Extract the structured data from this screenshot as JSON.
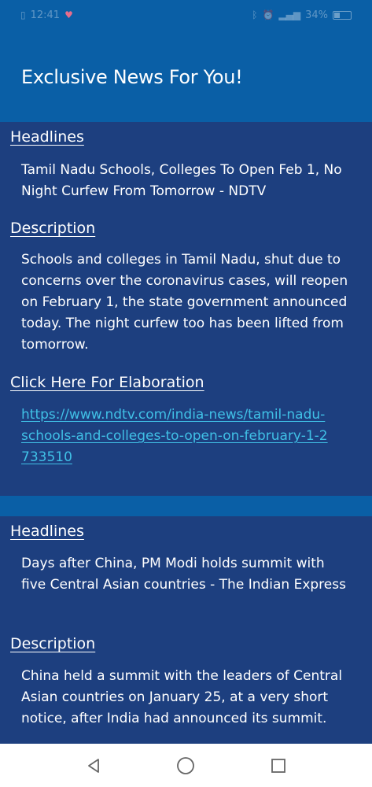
{
  "status_bar": {
    "time": "12:41",
    "battery": "34%"
  },
  "header": {
    "title": "Exclusive News For You!"
  },
  "articles": [
    {
      "headline_label": "Headlines",
      "headline": "Tamil Nadu Schools, Colleges To Open Feb 1, No Night Curfew From Tomorrow - NDTV",
      "description_label": "Description",
      "description": "Schools and colleges in Tamil Nadu, shut due to concerns over the coronavirus cases, will reopen on February 1, the state government announced today. The night curfew too has been lifted from tomorrow.",
      "link_label": "Click Here For Elaboration",
      "link_url": "https://www.ndtv.com/india-news/tamil-nadu-schools-and-colleges-to-open-on-february-1-2733510"
    },
    {
      "headline_label": "Headlines",
      "headline": "Days after China, PM Modi holds summit with five Central Asian countries - The Indian Express",
      "description_label": "Description",
      "description": "China held a summit with the leaders of Central Asian countries on January 25, at a very short notice, after India had announced its summit."
    }
  ],
  "colors": {
    "app_bar": "#0a5fa6",
    "card": "#1d3f7f",
    "link": "#40c0e6"
  },
  "icons": {
    "nav_back": "triangle-back-icon",
    "nav_home": "circle-home-icon",
    "nav_recents": "square-recents-icon"
  }
}
